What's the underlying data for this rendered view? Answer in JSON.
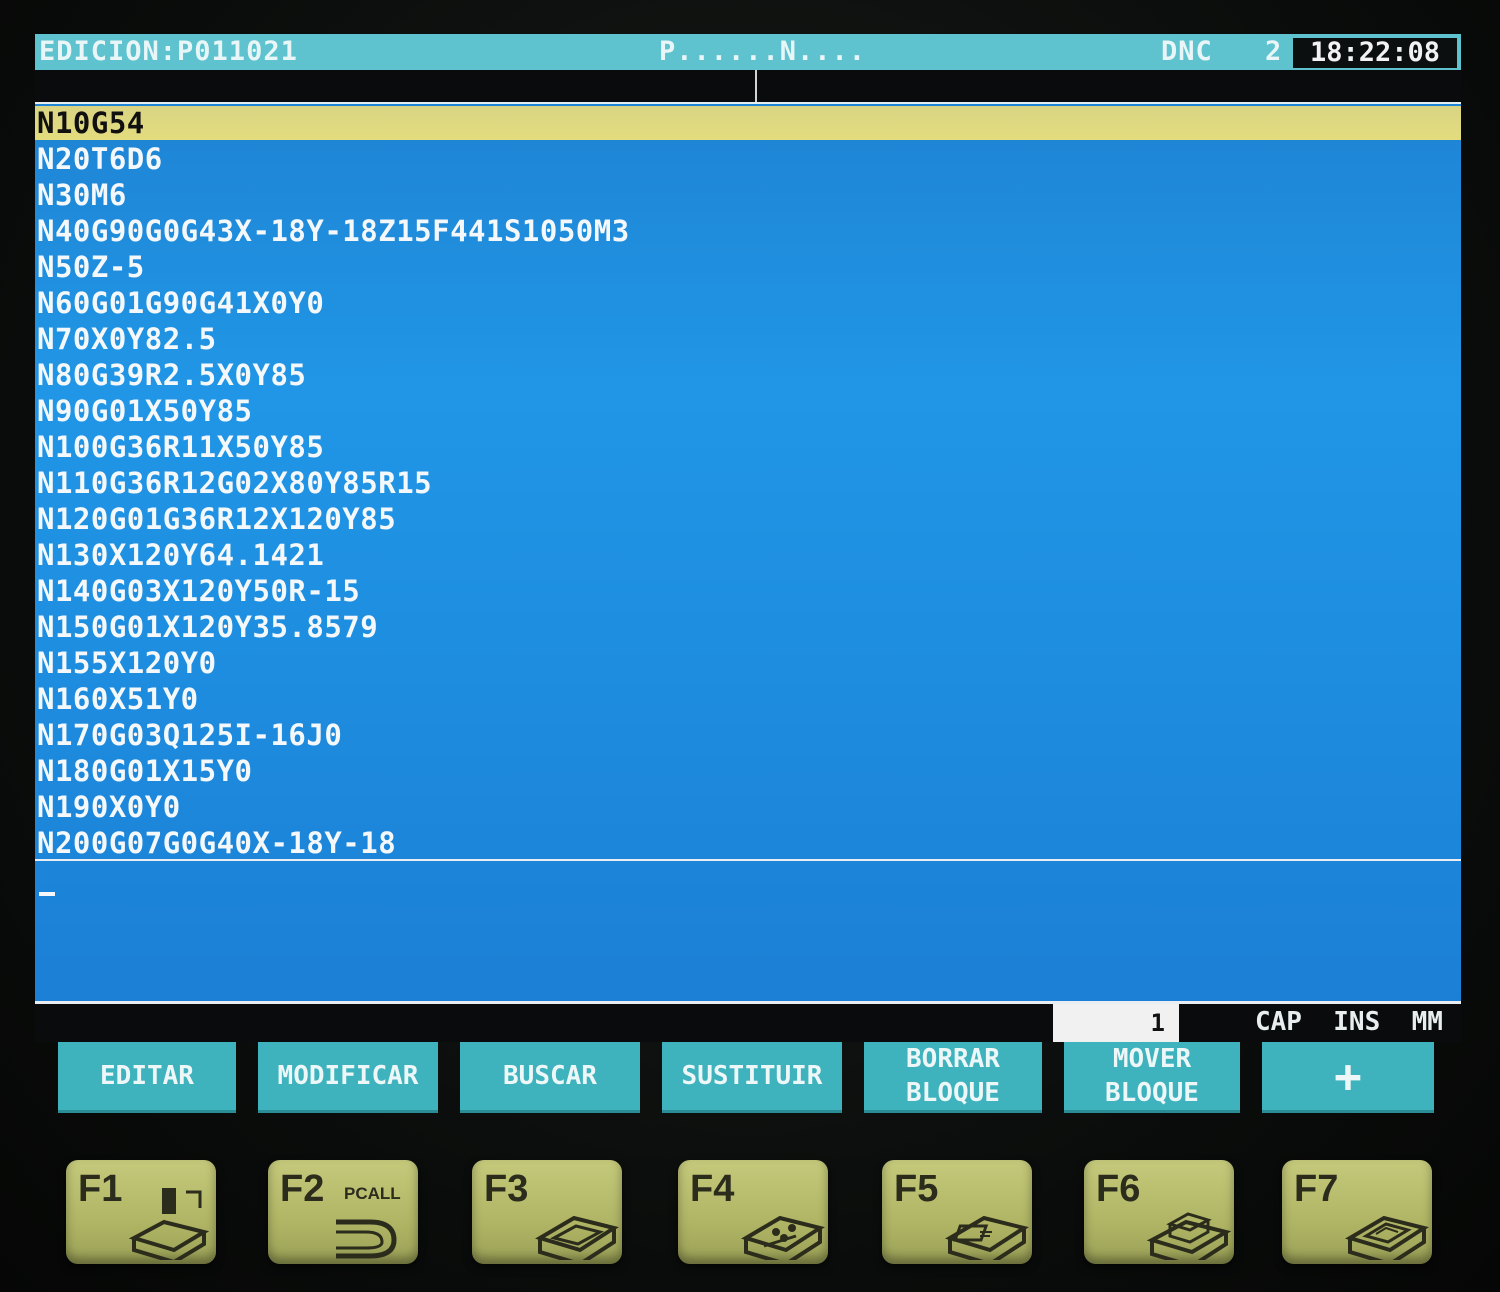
{
  "titlebar": {
    "mode": "EDICION:P011021",
    "program_indicator": "P......N....",
    "dnc": "DNC",
    "channel": "2",
    "clock": "18:22:08"
  },
  "program_lines": [
    "N10G54",
    "N20T6D6",
    "N30M6",
    "N40G90G0G43X-18Y-18Z15F441S1050M3",
    "N50Z-5",
    "N60G01G90G41X0Y0",
    "N70X0Y82.5",
    "N80G39R2.5X0Y85",
    "N90G01X50Y85",
    "N100G36R11X50Y85",
    "N110G36R12G02X80Y85R15",
    "N120G01G36R12X120Y85",
    "N130X120Y64.1421",
    "N140G03X120Y50R-15",
    "N150G01X120Y35.8579",
    "N155X120Y0",
    "N160X51Y0",
    "N170G03Q125I-16J0",
    "N180G01X15Y0",
    "N190X0Y0",
    "N200G07G0G40X-18Y-18"
  ],
  "status": {
    "counter": "1",
    "cap": "CAP",
    "ins": "INS",
    "units": "MM"
  },
  "softkeys": {
    "editar": "EDITAR",
    "modificar": "MODIFICAR",
    "buscar": "BUSCAR",
    "sustituir": "SUSTITUIR",
    "borrar_line1": "BORRAR",
    "borrar_line2": "BLOQUE",
    "mover_line1": "MOVER",
    "mover_line2": "BLOQUE",
    "more": "+"
  },
  "function_keys": {
    "f1": "F1",
    "f2": "F2",
    "f2_sub": "PCALL",
    "f3": "F3",
    "f4": "F4",
    "f5": "F5",
    "f6": "F6",
    "f7": "F7"
  },
  "colors": {
    "screen_blue": "#1e8ee0",
    "titlebar_cyan": "#5fc3cf",
    "selection_yellow": "#e3dc7e",
    "softkey_teal": "#3fb3bd",
    "fkey_olive": "#b0b565"
  }
}
